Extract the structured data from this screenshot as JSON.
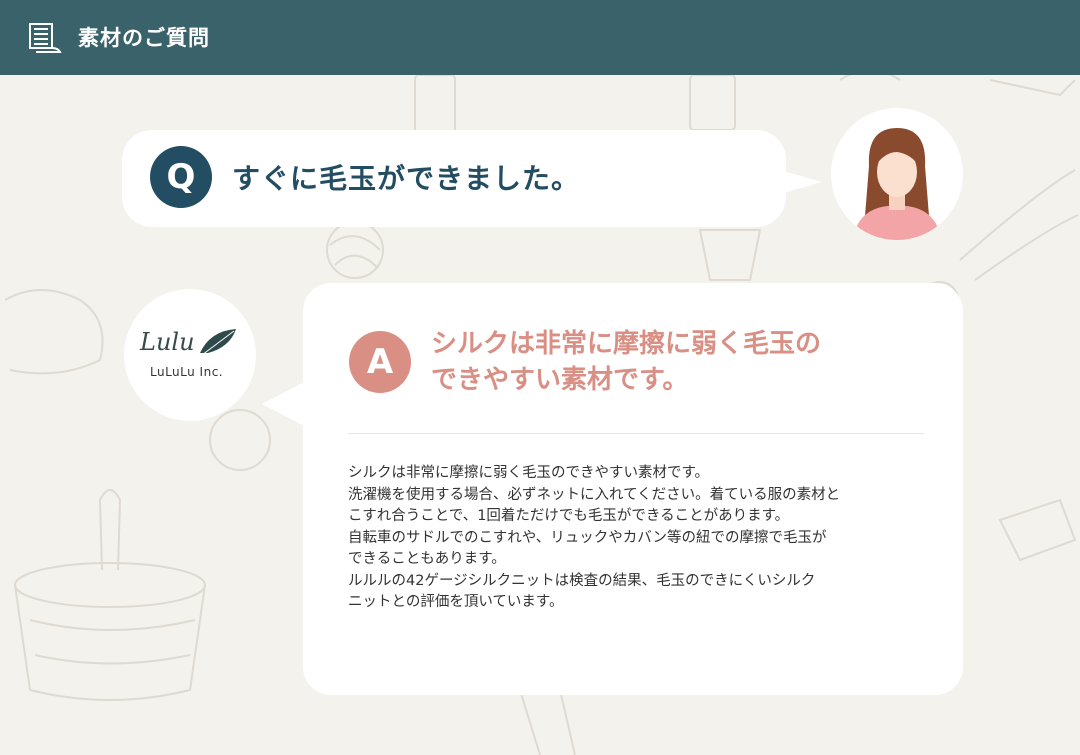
{
  "header": {
    "title": "素材のご質問",
    "icon": "fabric-roll-icon",
    "background": "#3a626a"
  },
  "question": {
    "badge": "Q",
    "text": "すぐに毛玉ができました。",
    "badge_color": "#234d63",
    "avatar": "woman-avatar-icon"
  },
  "answer": {
    "badge": "A",
    "headline_lines": [
      "シルクは非常に摩擦に弱く毛玉の",
      "できやすい素材です。"
    ],
    "badge_color": "#d98f84",
    "body_lines": [
      "シルクは非常に摩擦に弱く毛玉のできやすい素材です。",
      "洗濯機を使用する場合、必ずネットに入れてください。着ている服の素材と",
      "こすれ合うことで、1回着ただけでも毛玉ができることがあります。",
      "自転車のサドルでのこすれや、リュックやカバン等の紐での摩擦で毛玉が",
      "できることもあります。",
      "ルルルの42ゲージシルクニットは検査の結果、毛玉のできにくいシルク",
      "ニットとの評価を頂いています。"
    ]
  },
  "brand": {
    "logo_script": "Lulu",
    "company": "LuLuLu Inc.",
    "icon": "leaf-logo-icon"
  }
}
